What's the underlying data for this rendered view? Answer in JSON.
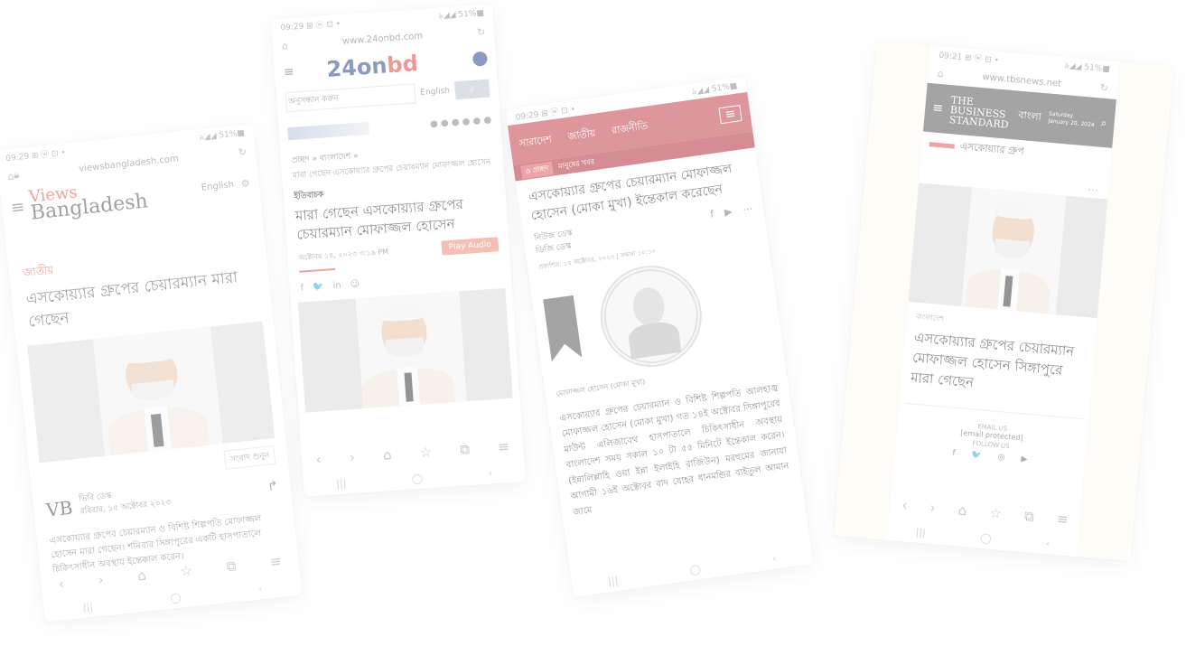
{
  "phone1": {
    "status_time": "09:29 ⊞ ⓦ ⊡ •",
    "status_right": "ঌ◢◢ 51%■",
    "url": "viewsbangladesh.com",
    "logo_top": "Views",
    "logo_bottom": "Bangladesh",
    "lang": "English",
    "category": "জাতীয়",
    "headline": "এসকোয়্যার গ্রুপের চেয়ারম্যান মারা গেছেন",
    "audio_label": "সংবাদ শুনুন",
    "author_initials": "VB",
    "author": "ভিবি ডেস্ক",
    "date": "রবিবার, ১৫ অক্টোবর ২০২৩",
    "body": "এসকোয়্যার গ্রুপের চেয়ারম্যান ও বিশিষ্ট শিল্পপতি মোফাজ্জল হোসেন মারা গেছেন। শনিবার সিঙ্গাপুরের একটি হাসপাতালে চিকিৎসাধীন অবস্থায় ইন্তেকাল করেন।"
  },
  "phone2": {
    "status_time": "09:29 ⊞ ⓦ ⊡ •",
    "status_right": "ঌ◢◢ 51%■",
    "url": "www.24onbd.com",
    "logo_main": "24on",
    "logo_suffix": "bd",
    "search_placeholder": "অনুসন্ধান করুন",
    "lang": "English",
    "breadcrumb": "প্রচ্ছদ » বাংলাদেশ »",
    "subcrumb": "মারা গেছেন এসকোয়্যার গ্রুপের চেয়ারম্যান মোফাজ্জল হোসেন",
    "tag": "ইতিবাচক",
    "headline": "মারা গেছেন এসকোয়্যার গ্রুপের চেয়ারম্যান মোফাজ্জল হোসেন",
    "date": "অক্টোবর ১৪, ২০২৩ ৩:১৯ PM",
    "play_audio": "Play Audio",
    "share": [
      "f",
      "🐦",
      "in",
      "☺"
    ]
  },
  "phone3": {
    "status_time": "09:29 ⊞ ⓦ ⊡ •",
    "status_right": "ঌ◢◢ 51%■",
    "menu": [
      "সারাদেশ",
      "জাতীয়",
      "রাজনীতি"
    ],
    "home_chip": "প্রচ্ছদ",
    "crumb_chip": "মানুষের খবর",
    "headline": "এসকোয়্যার গ্রুপের চেয়ারম্যান মোফাজ্জল হোসেন (মোকা মুখা) ইন্তেকাল করেছেন",
    "author": "নিউজ ডেস্ক",
    "author2": "ডিজি ডেস্ক",
    "published": "প্রকাশিত: ১৫ অক্টোবর, ২০২৩ | সকাল ১০:১০",
    "caption": "মোফাজ্জল হোসেন (মোকা মুখা)",
    "body": "এসকোয়্যার গ্রুপের চেয়ারম্যান ও বিশিষ্ট শিল্পপতি আলহাজ্ব মোফাজ্জল হোসেন (মোকা মুখা) গত ১৪ই অক্টোবর সিঙ্গাপুরের মাউন্ট এলিজাবেথ হাসপাতালে চিকিৎসাধীন অবস্থায় বাংলাদেশ সময় সকাল ১০ টা ৫৫ মিনিটে ইন্তেকাল করেন। (ইন্নালিল্লাহি ওয়া ইন্না ইলাইহি রাজিউন) মরহুমের জানাযা আগামী ১৬ই অক্টোবর বাদ যোহর ধানমন্ডির বাইতুল আমান জামে"
  },
  "phone4": {
    "status_time": "09:21 ⊞ ⓦ ⊡ •",
    "status_right": "ঌ◢◢ 51%■",
    "url": "www.tbsnews.net",
    "logo_line1": "The",
    "logo_line2": "Business",
    "logo_line3": "Standard",
    "lang": "বাংলা",
    "day": "Saturday",
    "date": "January 20, 2024",
    "section": "এসকোয়্যার গ্রুপ",
    "category": "বাংলাদেশ",
    "headline": "এসকোয়্যার গ্রুপের চেয়ারম্যান মোফাজ্জল হোসেন সিঙ্গাপুরে মারা গেছেন",
    "email_label": "EMAIL US",
    "email": "[email protected]",
    "follow": "FOLLOW US",
    "socials": [
      "f",
      "🐦",
      "◎",
      "▶"
    ]
  },
  "nav_icons": [
    "‹",
    "›",
    "⌂",
    "☆",
    "⧉",
    "≡"
  ],
  "sys_icons": [
    "|||",
    "◯",
    "‹"
  ]
}
